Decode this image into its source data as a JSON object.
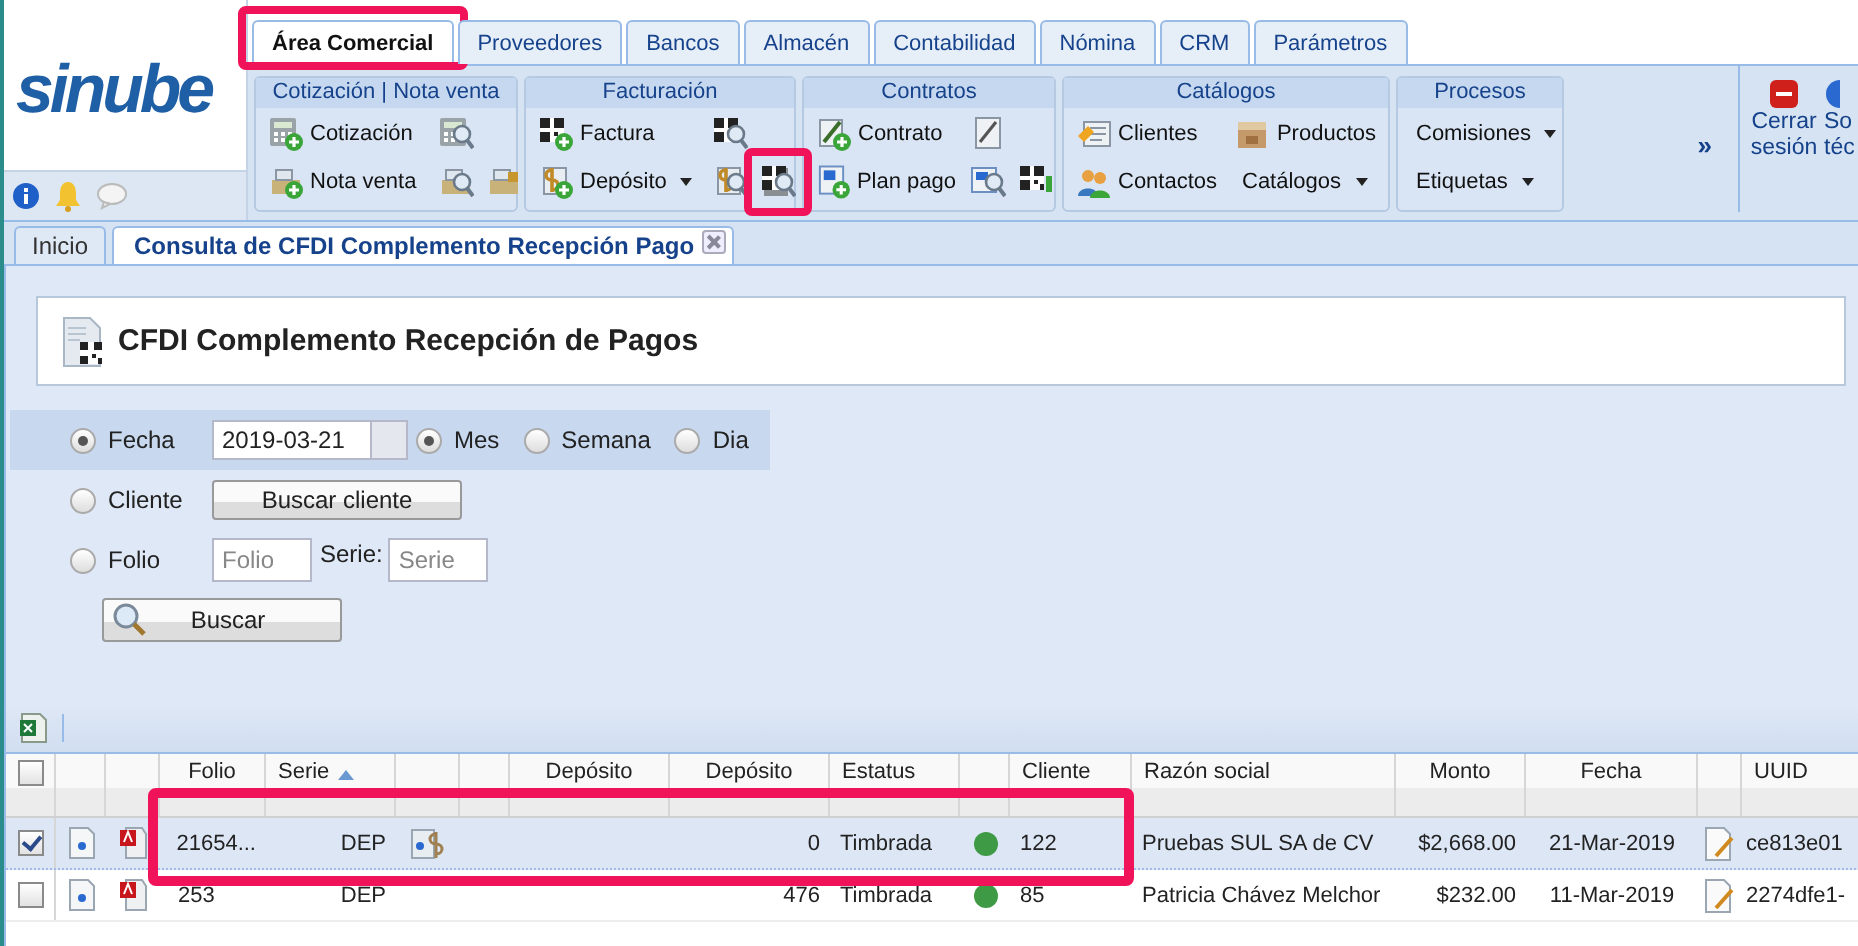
{
  "logo": "sinube",
  "main_tabs": [
    {
      "label": "Área Comercial",
      "selected": true,
      "highlighted": true
    },
    {
      "label": "Proveedores",
      "selected": false,
      "highlighted": false
    },
    {
      "label": "Bancos",
      "selected": false,
      "highlighted": false
    },
    {
      "label": "Almacén",
      "selected": false,
      "highlighted": false
    },
    {
      "label": "Contabilidad",
      "selected": false,
      "highlighted": false
    },
    {
      "label": "Nómina",
      "selected": false,
      "highlighted": false
    },
    {
      "label": "CRM",
      "selected": false,
      "highlighted": false
    },
    {
      "label": "Parámetros",
      "selected": false,
      "highlighted": false
    }
  ],
  "ribbon": {
    "groups": [
      {
        "title": "Cotización | Nota venta",
        "rows": [
          [
            {
              "kind": "button",
              "label": "Cotización"
            },
            {
              "kind": "tool",
              "highlighted": false
            }
          ],
          [
            {
              "kind": "button",
              "label": "Nota venta"
            },
            {
              "kind": "tool",
              "highlighted": false
            },
            {
              "kind": "tool",
              "highlighted": false
            }
          ]
        ]
      },
      {
        "title": "Facturación",
        "rows": [
          [
            {
              "kind": "button",
              "label": "Factura"
            },
            {
              "kind": "tool",
              "highlighted": false
            }
          ],
          [
            {
              "kind": "dropdown",
              "label": "Depósito"
            },
            {
              "kind": "tool",
              "highlighted": false
            },
            {
              "kind": "tool",
              "highlighted": true
            }
          ]
        ]
      },
      {
        "title": "Contratos",
        "rows": [
          [
            {
              "kind": "button",
              "label": "Contrato"
            },
            {
              "kind": "tool",
              "highlighted": false
            }
          ],
          [
            {
              "kind": "button",
              "label": "Plan pago"
            },
            {
              "kind": "tool",
              "highlighted": false
            },
            {
              "kind": "tool",
              "highlighted": false
            }
          ]
        ]
      },
      {
        "title": "Catálogos",
        "rows": [
          [
            {
              "kind": "button",
              "label": "Clientes"
            },
            {
              "kind": "button",
              "label": "Productos"
            }
          ],
          [
            {
              "kind": "button",
              "label": "Contactos"
            },
            {
              "kind": "dropdown",
              "label": "Catálogos"
            }
          ]
        ]
      },
      {
        "title": "Procesos",
        "rows": [
          [
            {
              "kind": "dropdown",
              "label": "Comisiones"
            }
          ],
          [
            {
              "kind": "dropdown",
              "label": "Etiquetas"
            }
          ]
        ]
      }
    ],
    "more": "»",
    "actions": [
      {
        "label": "Cerrar sesión"
      },
      {
        "label": "So téc"
      }
    ]
  },
  "doc_tabs": [
    {
      "label": "Inicio",
      "selected": false,
      "closable": false
    },
    {
      "label": "Consulta de CFDI Complemento Recepción Pago",
      "selected": true,
      "closable": true
    }
  ],
  "page_title": "CFDI Complemento Recepción de Pagos",
  "filters": {
    "date": {
      "label": "Fecha",
      "selected": true,
      "value": "2019-03-21",
      "periods": [
        {
          "label": "Mes",
          "selected": true
        },
        {
          "label": "Semana",
          "selected": false
        },
        {
          "label": "Dia",
          "selected": false
        }
      ]
    },
    "client": {
      "label": "Cliente",
      "selected": false,
      "button": "Buscar cliente"
    },
    "folio": {
      "label": "Folio",
      "selected": false,
      "placeholder": "Folio",
      "serie_label": "Serie:",
      "serie_placeholder": "Serie"
    },
    "search_button": "Buscar"
  },
  "grid": {
    "select_all": false,
    "columns": [
      {
        "label": "Folio",
        "sorted": false
      },
      {
        "label": "Serie",
        "sorted": true
      },
      {
        "label": "Depósito",
        "sorted": false
      },
      {
        "label": "Depósito",
        "sorted": false
      },
      {
        "label": "Estatus",
        "sorted": false
      },
      {
        "label": "Cliente",
        "sorted": false
      },
      {
        "label": "Razón social",
        "sorted": false
      },
      {
        "label": "Monto",
        "sorted": false
      },
      {
        "label": "Fecha",
        "sorted": false
      },
      {
        "label": "UUID",
        "sorted": false
      }
    ],
    "rows": [
      {
        "checked": true,
        "selected": true,
        "highlighted": true,
        "deposit_icon": true,
        "cells": [
          "21654...",
          "DEP",
          "",
          "0",
          "Timbrada",
          "122",
          "Pruebas SUL SA de CV",
          "$2,668.00",
          "21-Mar-2019",
          "ce813e01"
        ],
        "color": "#3f9a45"
      },
      {
        "checked": false,
        "selected": false,
        "highlighted": false,
        "deposit_icon": false,
        "cells": [
          "253",
          "DEP",
          "",
          "476",
          "Timbrada",
          "85",
          "Patricia Chávez Melchor",
          "$232.00",
          "11-Mar-2019",
          "2274dfe1-"
        ],
        "color": "#3f9a45"
      }
    ]
  }
}
